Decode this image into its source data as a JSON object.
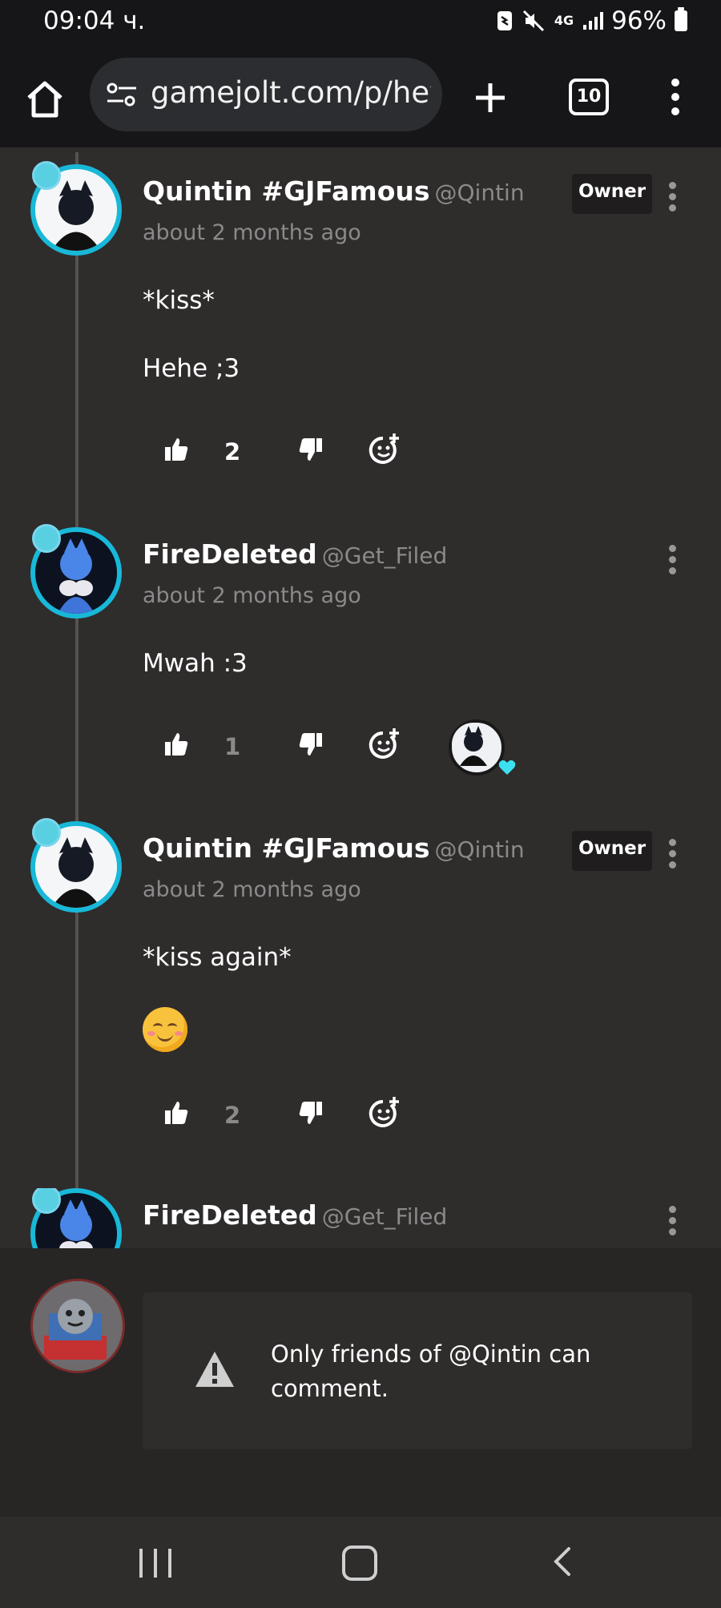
{
  "status_bar": {
    "time": "09:04 ч.",
    "network": "4G",
    "battery": "96%"
  },
  "browser": {
    "url": "gamejolt.com/p/hey-",
    "tab_count": "10"
  },
  "comments": [
    {
      "name": "Quintin #GJFamous",
      "handle": "@Qintin",
      "badge": "Owner",
      "time": "about 2 months ago",
      "lines": [
        "*kiss*",
        "Hehe ;3"
      ],
      "likes": "2"
    },
    {
      "name": "FireDeleted",
      "handle": "@Get_Filed",
      "time": "about 2 months ago",
      "lines": [
        "Mwah :3"
      ],
      "likes": "1"
    },
    {
      "name": "Quintin #GJFamous",
      "handle": "@Qintin",
      "badge": "Owner",
      "time": "about 2 months ago",
      "lines": [
        "*kiss again*"
      ],
      "likes": "2"
    },
    {
      "name": "FireDeleted",
      "handle": "@Get_Filed"
    }
  ],
  "notice": {
    "text": "Only friends of @Qintin can comment."
  },
  "colors": {
    "background": "#2f2c2c",
    "avatar_ring": "#18b8d8",
    "muted_text": "#8b8989",
    "browser_bar": "#161618"
  }
}
